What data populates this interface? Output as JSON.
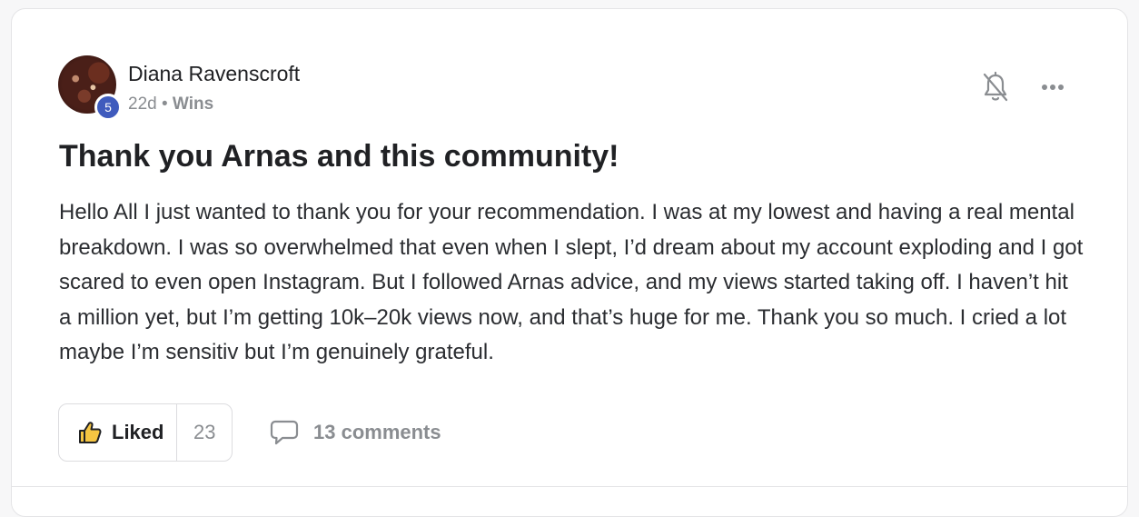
{
  "post": {
    "author": {
      "name": "Diana Ravenscroft",
      "level": "5",
      "avatar_icon": "user-avatar-photo"
    },
    "meta": {
      "time": "22d",
      "separator": "•",
      "category": "Wins"
    },
    "title": "Thank you Arnas and this community!",
    "body": "Hello All I just wanted to thank you for your recommendation. I was at my lowest and having a real mental breakdown. I was so overwhelmed that even when I slept, I’d dream about my account exploding and I got scared to even open Instagram. But I followed Arnas advice, and my views started taking off. I haven’t hit a million yet, but I’m getting 10k–20k views now, and that’s huge for me. Thank you so much. I cried a lot maybe I’m sensitiv but I’m genuinely grateful.",
    "actions": {
      "like_label": "Liked",
      "like_count": "23",
      "comments_label": "13 comments"
    },
    "icons": {
      "bell": "bell-icon",
      "more": "more-icon",
      "like": "thumbs-up-icon",
      "comment": "comment-icon"
    },
    "colors": {
      "level_badge": "#3f5bbd",
      "muted_text": "#8a8d91",
      "like_icon_fill": "#f5c542"
    }
  }
}
